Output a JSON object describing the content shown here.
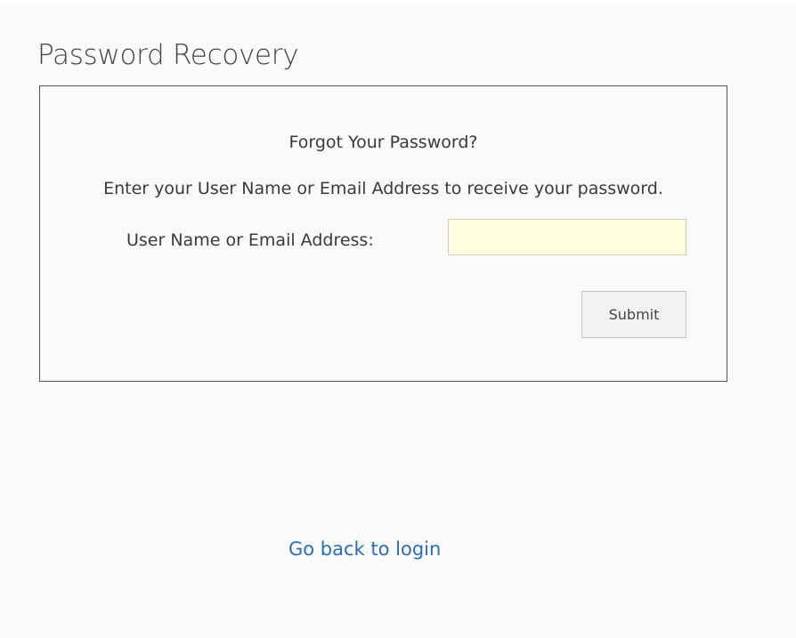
{
  "page": {
    "title": "Password Recovery"
  },
  "recovery_form": {
    "heading": "Forgot Your Password?",
    "instructions": "Enter your User Name or Email Address to receive your password.",
    "field_label": "User Name or Email Address:",
    "field_value": "",
    "field_placeholder": "",
    "submit_label": "Submit"
  },
  "footer": {
    "back_link_label": "Go back to login"
  },
  "colors": {
    "background": "#fafafa",
    "input_background": "#ffffe0",
    "link": "#2a6ebb",
    "border": "#555555"
  }
}
